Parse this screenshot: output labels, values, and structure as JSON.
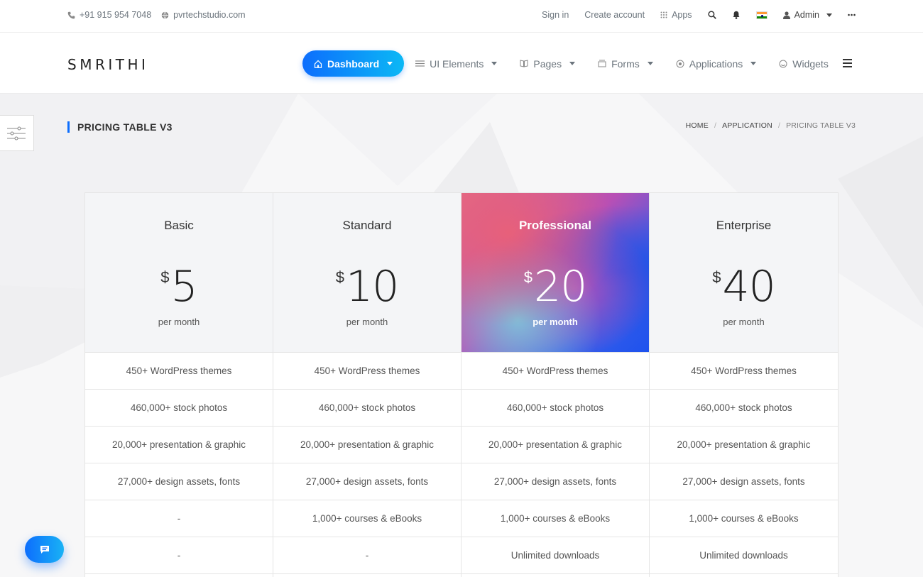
{
  "topbar": {
    "phone": "+91 915 954 7048",
    "website": "pvrtechstudio.com",
    "sign_in": "Sign in",
    "create_account": "Create account",
    "apps": "Apps",
    "admin": "Admin",
    "icons": [
      "phone-icon",
      "globe-icon",
      "apps-grid-icon",
      "search-icon",
      "bell-icon",
      "india-flag-icon",
      "user-icon",
      "more-dots-icon"
    ]
  },
  "header": {
    "brand": "SMRITHI",
    "nav": [
      {
        "label": "Dashboard",
        "icon": "home-icon",
        "active": true
      },
      {
        "label": "UI Elements",
        "icon": "sliders-icon"
      },
      {
        "label": "Pages",
        "icon": "book-icon"
      },
      {
        "label": "Forms",
        "icon": "inbox-icon"
      },
      {
        "label": "Applications",
        "icon": "target-icon"
      },
      {
        "label": "Widgets",
        "icon": "smile-icon"
      }
    ],
    "accent": "#0d6efd"
  },
  "page": {
    "title": "PRICING TABLE V3",
    "breadcrumb": [
      "HOME",
      "APPLICATION",
      "PRICING TABLE V3"
    ]
  },
  "plans": [
    {
      "name": "Basic",
      "currency": "$",
      "price": "5",
      "period": "per month",
      "features": [
        "450+ WordPress themes",
        "460,000+ stock photos",
        "20,000+ presentation & graphic",
        "27,000+ design assets, fonts",
        "-",
        "-"
      ]
    },
    {
      "name": "Standard",
      "currency": "$",
      "price": "10",
      "period": "per month",
      "features": [
        "450+ WordPress themes",
        "460,000+ stock photos",
        "20,000+ presentation & graphic",
        "27,000+ design assets, fonts",
        "1,000+ courses & eBooks",
        "-"
      ]
    },
    {
      "name": "Professional",
      "currency": "$",
      "price": "20",
      "period": "per month",
      "featured": true,
      "features": [
        "450+ WordPress themes",
        "460,000+ stock photos",
        "20,000+ presentation & graphic",
        "27,000+ design assets, fonts",
        "1,000+ courses & eBooks",
        "Unlimited downloads"
      ]
    },
    {
      "name": "Enterprise",
      "currency": "$",
      "price": "40",
      "period": "per month",
      "features": [
        "450+ WordPress themes",
        "460,000+ stock photos",
        "20,000+ presentation & graphic",
        "27,000+ design assets, fonts",
        "1,000+ courses & eBooks",
        "Unlimited downloads"
      ]
    }
  ]
}
